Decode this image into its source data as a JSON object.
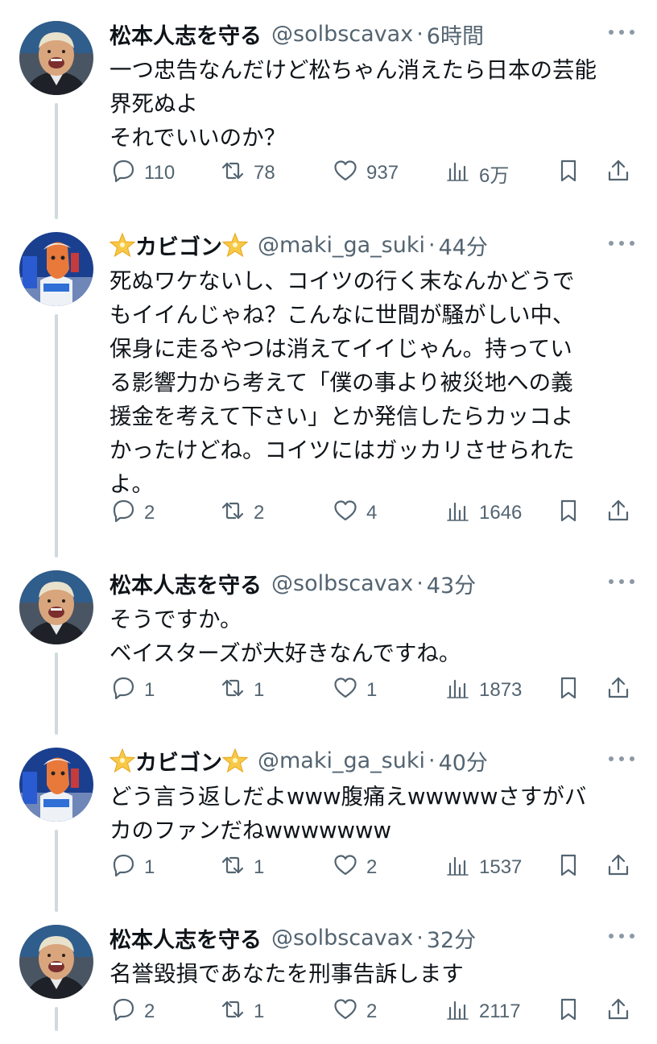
{
  "tweets": [
    {
      "name": "松本人志を守る",
      "handle": "@solbscavax",
      "time": "6時間",
      "text": "一つ忠告なんだけど松ちゃん消えたら日本の芸能\n界死ぬよ\nそれでいいのか？",
      "replies": "110",
      "retweets": "78",
      "likes": "937",
      "views": "6万",
      "avatar": "comedian-avatar"
    },
    {
      "name": "カビゴン",
      "handle": "@maki_ga_suki",
      "time": "44分",
      "text": "死ぬワケないし、コイツの行く末なんかどうで\nもイイんじゃね？こんなに世間が騒がしい中、\n保身に走るやつは消えてイイじゃん。持ってい\nる影響力から考えて「僕の事より被災地への義\n援金を考えて下さい」とか発信したらカッコよ\nかったけどね。コイツにはガッカリさせられた\nよ。",
      "replies": "2",
      "retweets": "2",
      "likes": "4",
      "views": "1646",
      "avatar": "mascot-avatar"
    },
    {
      "name": "松本人志を守る",
      "handle": "@solbscavax",
      "time": "43分",
      "text": "そうですか。\nベイスターズが大好きなんですね。",
      "replies": "1",
      "retweets": "1",
      "likes": "1",
      "views": "1873",
      "avatar": "comedian-avatar"
    },
    {
      "name": "カビゴン",
      "handle": "@maki_ga_suki",
      "time": "40分",
      "text": "どう言う返しだよwww腹痛えwwwwwさすがバ\nカのファンだねwwwwwww",
      "replies": "1",
      "retweets": "1",
      "likes": "2",
      "views": "1537",
      "avatar": "mascot-avatar"
    },
    {
      "name": "松本人志を守る",
      "handle": "@solbscavax",
      "time": "32分",
      "text": "名誉毀損であなたを刑事告訴します",
      "replies": "2",
      "retweets": "1",
      "likes": "2",
      "views": "2117",
      "avatar": "comedian-avatar"
    }
  ],
  "icons": {
    "reply": "reply-icon",
    "retweet": "retweet-icon",
    "like": "heart-icon",
    "views": "views-icon",
    "bookmark": "bookmark-icon",
    "share": "share-icon",
    "more": "more-icon",
    "star": "star-emoji-icon"
  },
  "colors": {
    "text": "#0f1419",
    "muted": "#536471",
    "thread_line": "#cfd9de",
    "star": "#f5c542"
  }
}
